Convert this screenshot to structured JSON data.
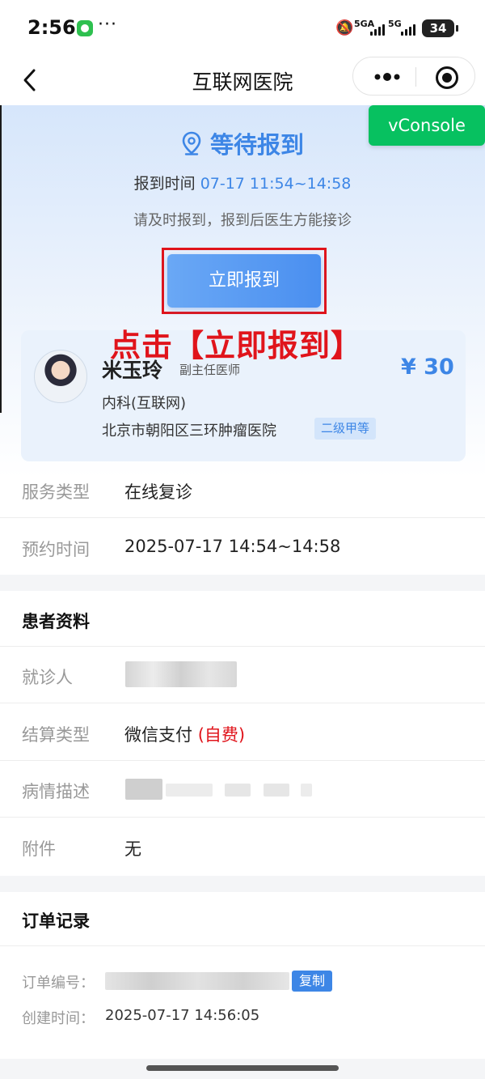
{
  "status_bar": {
    "time": "2:56",
    "net_1": "5GA",
    "net_2": "5G",
    "battery": "34"
  },
  "nav": {
    "title": "互联网医院"
  },
  "vconsole_label": "vConsole",
  "checkin": {
    "status_title": "等待报到",
    "time_label": "报到时间",
    "time_value": "07-17 11:54~14:58",
    "hint": "请及时报到，报到后医生方能接诊",
    "button_label": "立即报到",
    "annotation": "点击【立即报到】"
  },
  "doctor": {
    "name": "米玉玲",
    "title": "副主任医师",
    "price": "¥ 30",
    "department": "内科(互联网)",
    "hospital": "北京市朝阳区三环肿瘤医院",
    "hospital_level": "二级甲等"
  },
  "service": {
    "type_label": "服务类型",
    "type_value": "在线复诊",
    "appointment_label": "预约时间",
    "appointment_value": "2025-07-17 14:54~14:58"
  },
  "patient": {
    "section_title": "患者资料",
    "patient_label": "就诊人",
    "payment_label": "结算类型",
    "payment_value": "微信支付",
    "payment_note": "(自费)",
    "condition_label": "病情描述",
    "attachment_label": "附件",
    "attachment_value": "无"
  },
  "order": {
    "section_title": "订单记录",
    "number_label": "订单编号：",
    "copy_label": "复制",
    "created_label": "创建时间：",
    "created_value": "2025-07-17 14:56:05"
  },
  "colors": {
    "accent_blue": "#3d86e6",
    "annotation_red": "#e0141b",
    "vconsole_green": "#07c160"
  }
}
